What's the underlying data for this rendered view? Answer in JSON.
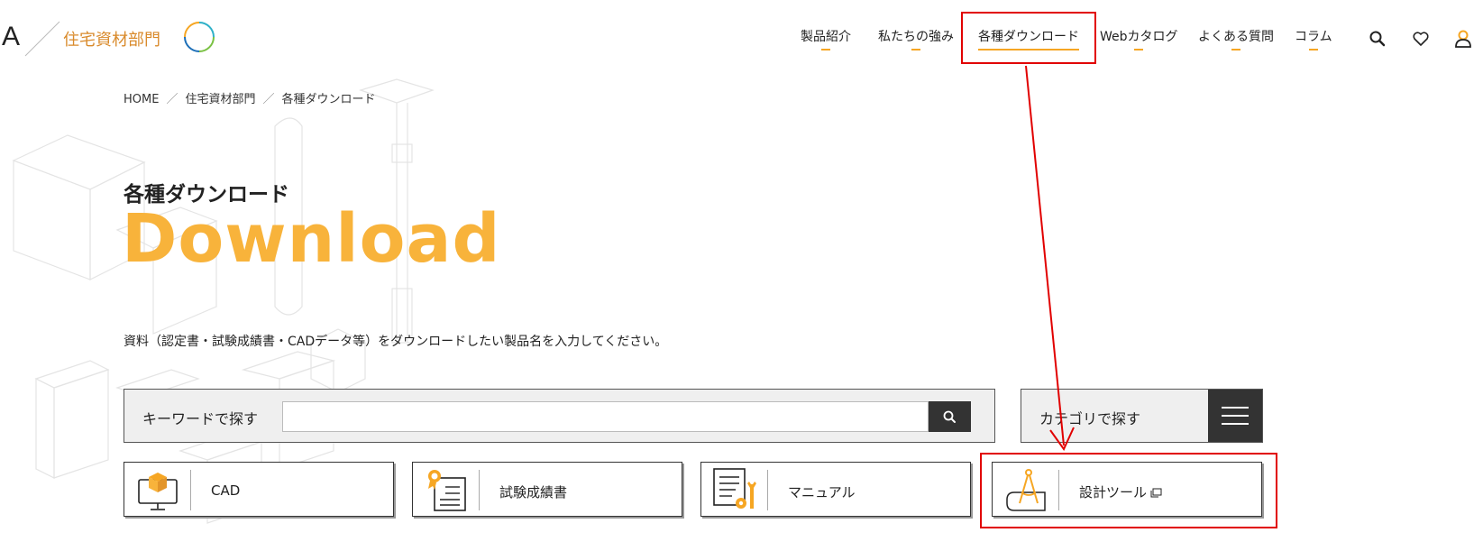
{
  "header": {
    "brand_letter": "A",
    "brand_name": "住宅資材部門",
    "nav": [
      {
        "label": "製品紹介"
      },
      {
        "label": "私たちの強み"
      },
      {
        "label": "各種ダウンロード",
        "active": true
      },
      {
        "label": "Webカタログ"
      },
      {
        "label": "よくある質問"
      },
      {
        "label": "コラム"
      }
    ],
    "icons": [
      "search-icon",
      "heart-icon",
      "user-icon"
    ]
  },
  "breadcrumb": {
    "items": [
      "HOME",
      "住宅資材部門",
      "各種ダウンロード"
    ],
    "separator": "／"
  },
  "page": {
    "title_ja": "各種ダウンロード",
    "title_en": "Download",
    "description": "資料（認定書・試験成績書・CADデータ等）をダウンロードしたい製品名を入力してください。"
  },
  "search": {
    "keyword_label": "キーワードで探す",
    "placeholder": "",
    "category_label": "カテゴリで探す"
  },
  "cards": [
    {
      "label": "CAD",
      "icon": "computer-box-icon"
    },
    {
      "label": "試験成績書",
      "icon": "certificate-icon"
    },
    {
      "label": "マニュアル",
      "icon": "manual-tools-icon"
    },
    {
      "label": "設計ツール",
      "icon": "compass-blueprint-icon",
      "external": true
    }
  ],
  "colors": {
    "accent": "#f8b33b",
    "brand": "#d98a2b",
    "highlight": "#e10000",
    "dark": "#333333"
  }
}
